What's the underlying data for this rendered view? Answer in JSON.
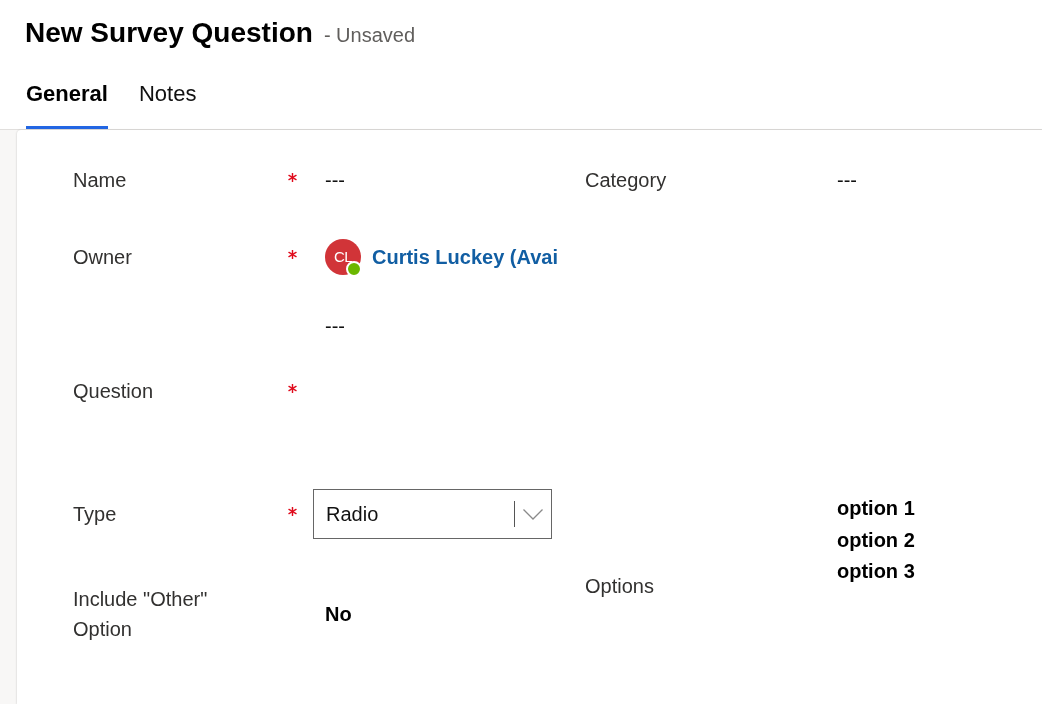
{
  "header": {
    "title": "New Survey Question",
    "status": "- Unsaved"
  },
  "tabs": [
    {
      "label": "General",
      "selected": true
    },
    {
      "label": "Notes",
      "selected": false
    }
  ],
  "form": {
    "left_fields": [
      {
        "kind": "text",
        "label": "Name",
        "required": true,
        "value": "---"
      },
      {
        "kind": "lookup",
        "label": "Owner",
        "required": true,
        "avatar_initials": "CL",
        "available": true,
        "value": "Curtis Luckey (Avai"
      },
      {
        "kind": "text",
        "required": false,
        "value": "---"
      },
      {
        "kind": "longtext",
        "label": "Question",
        "required": true
      },
      {
        "kind": "choice",
        "label": "Type",
        "required": true,
        "value": "Radio"
      },
      {
        "kind": "boolean",
        "label": "Include \"Other\" Option",
        "required": false,
        "value": "No"
      }
    ],
    "right_fields": [
      {
        "kind": "text",
        "label": "Category",
        "required": false,
        "value": "---"
      },
      {
        "kind": "list",
        "label": "Options",
        "required": false,
        "values": [
          "option 1",
          "option 2",
          "option 3"
        ]
      }
    ]
  }
}
